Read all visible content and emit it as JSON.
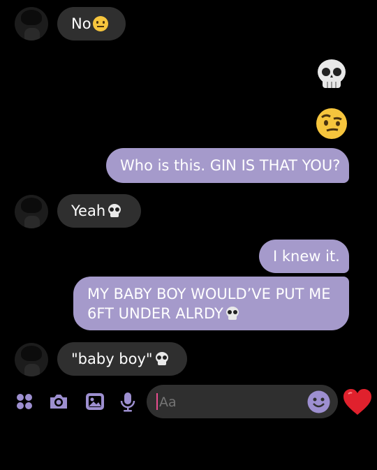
{
  "messages": [
    {
      "side": "in",
      "text": "No",
      "emoji": "neutral-face"
    },
    {
      "side": "out",
      "emoji": "skull"
    },
    {
      "side": "out",
      "emoji": "face-with-raised-eyebrow"
    },
    {
      "side": "out",
      "text": "Who is this. GIN IS THAT YOU?"
    },
    {
      "side": "in",
      "text": "Yeah",
      "emoji": "skull"
    },
    {
      "side": "out",
      "text": "I knew it."
    },
    {
      "side": "out",
      "text_line1": "MY BABY BOY WOULD’VE PUT ME",
      "text_line2": "6FT UNDER ALRDY",
      "emoji": "skull"
    },
    {
      "side": "in",
      "text": "\"baby boy\"",
      "emoji": "skull"
    }
  ],
  "composer": {
    "placeholder": "Aa",
    "icons": [
      "apps-grid-icon",
      "camera-icon",
      "image-icon",
      "microphone-icon",
      "emoji-icon",
      "heart-icon"
    ]
  },
  "colors": {
    "outgoing_bubble": "#a59acb",
    "incoming_bubble": "#2f2f2f",
    "accent": "#9d8fd0",
    "heart": "#e0212d"
  }
}
